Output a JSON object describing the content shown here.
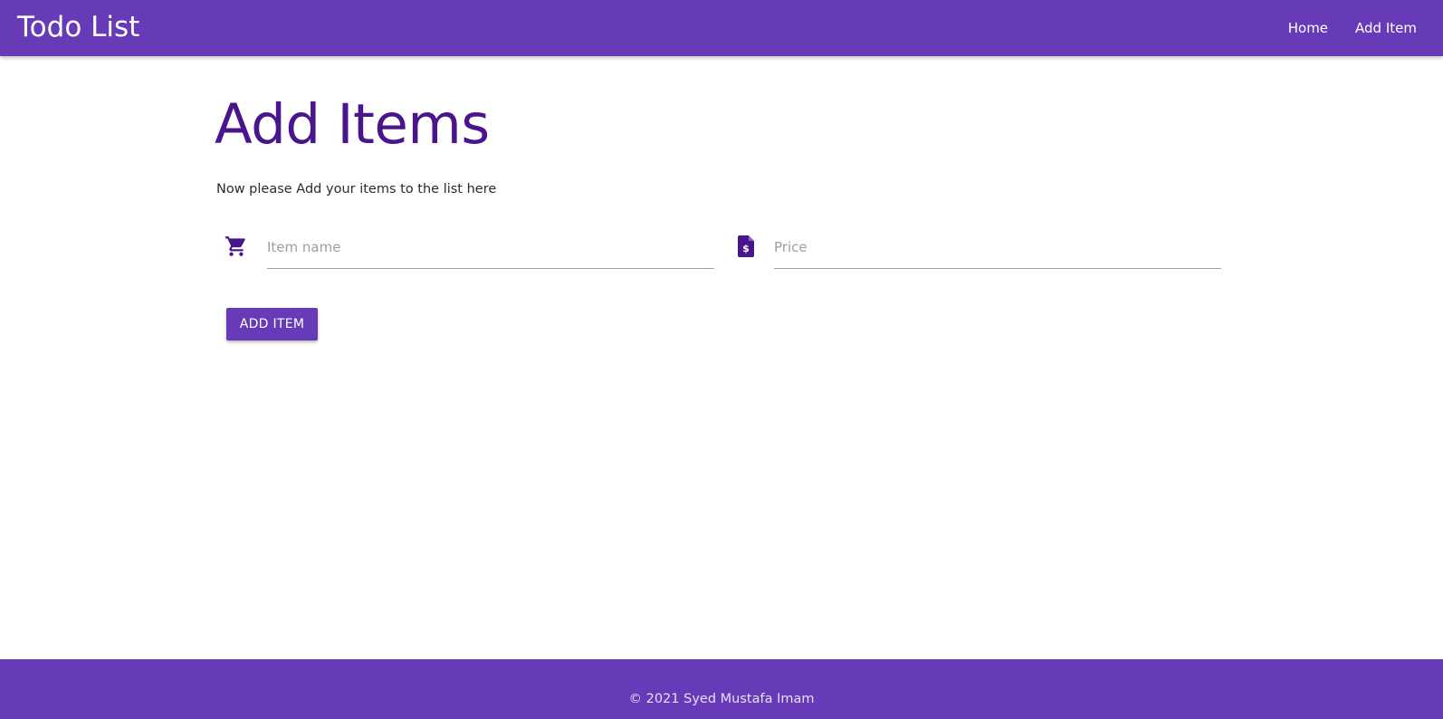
{
  "navbar": {
    "brand": "Todo List",
    "links": [
      {
        "label": "Home"
      },
      {
        "label": "Add Item"
      }
    ]
  },
  "main": {
    "title": "Add Items",
    "subtitle": "Now please Add your items to the list here",
    "fields": {
      "item_name": {
        "icon": "shopping-cart-icon",
        "placeholder": "Item name",
        "value": ""
      },
      "price": {
        "icon": "invoice-dollar-icon",
        "placeholder": "Price",
        "value": ""
      }
    },
    "add_button_label": "ADD ITEM"
  },
  "footer": {
    "text": "© 2021 Syed Mustafa Imam"
  },
  "colors": {
    "primary": "#673ab7",
    "title": "#4a148c",
    "icon": "#4a148c"
  }
}
